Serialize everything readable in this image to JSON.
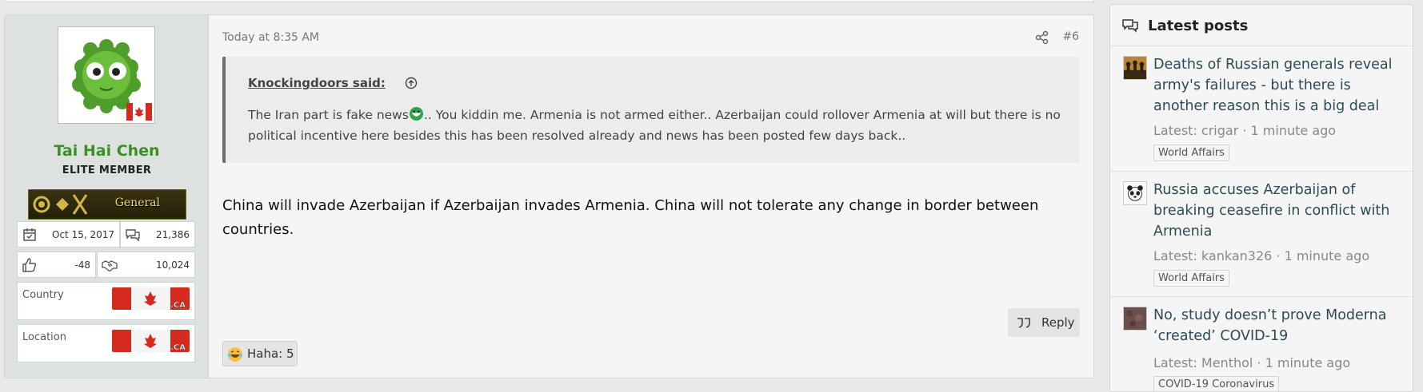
{
  "post": {
    "user": {
      "name": "Tai Hai Chen",
      "title": "ELITE MEMBER",
      "rank_label": "General",
      "joined": "Oct 15, 2017",
      "messages": "21,386",
      "reaction_score": "-48",
      "points": "10,024",
      "country_label": "Country",
      "location_label": "Location",
      "flag_text": ".CA"
    },
    "date": "Today at 8:35 AM",
    "number": "#6",
    "quote": {
      "author": "Knockingdoors said:",
      "text_before_emoji": "The Iran part is fake news",
      "text_after_emoji": ".. You kiddin me. Armenia is not armed either.. Azerbaijan could rollover Armenia at will but there is no political incentive here besides this has been resolved already and news has been posted few days back.."
    },
    "message": "China will invade Azerbaijan if Azerbaijan invades Armenia. China will not tolerate any change in border between countries.",
    "reply_label": "Reply",
    "reaction_label": "Haha: 5"
  },
  "sidebar": {
    "title": "Latest posts",
    "items": [
      {
        "title": "Deaths of Russian generals reveal army's failures - but there is another reason this is a big deal",
        "meta": "Latest: crigar · 1 minute ago",
        "tag": "World Affairs"
      },
      {
        "title": "Russia accuses Azerbaijan of breaking ceasefire in conflict with Armenia",
        "meta": "Latest: kankan326 · 1 minute ago",
        "tag": "World Affairs"
      },
      {
        "title": "No, study doesn’t prove Moderna ‘created’ COVID-19",
        "meta": "Latest: Menthol · 1 minute ago",
        "tag": "COVID-19 Coronavirus"
      }
    ]
  },
  "colors": {
    "username": "#3e8f23",
    "link": "#2e4a55",
    "user_column_bg": "#dde2e1",
    "page_bg": "#e8e9eb"
  }
}
